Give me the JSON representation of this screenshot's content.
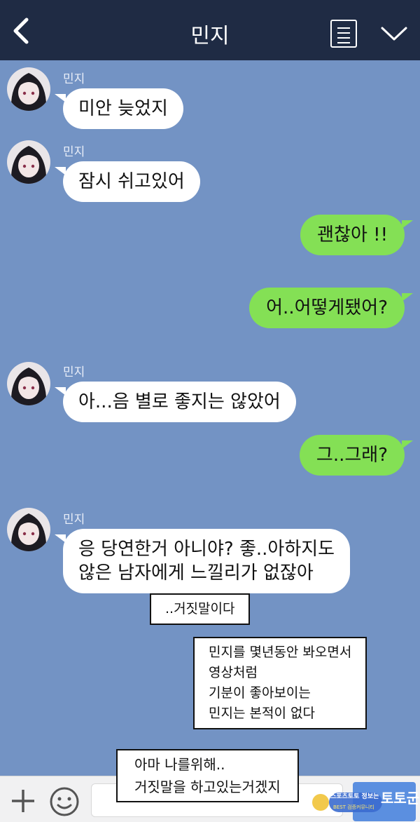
{
  "header": {
    "title": "민지"
  },
  "chat": {
    "contact": "민지",
    "messages": [
      {
        "from": "in",
        "text": "미안 늦었지"
      },
      {
        "from": "in",
        "text": "잠시 쉬고있어"
      },
      {
        "from": "out",
        "text": "괜찮아 !!"
      },
      {
        "from": "out",
        "text": "어..어떻게됐어?"
      },
      {
        "from": "in",
        "text": "아...음 별로 좋지는 않았어"
      },
      {
        "from": "out",
        "text": "그..그래?"
      },
      {
        "from": "in",
        "text": "응 당연한거 아니야? 좋..아하지도\n않은 남자에게 느낄리가 없잖아"
      }
    ],
    "narration": [
      "..거짓말이다",
      "민지를 몇년동안 봐오면서\n영상처럼\n기분이 좋아보이는\n민지는 본적이 없다",
      "아마 나를위해..\n거짓말을 하고있는거겠지"
    ]
  },
  "input": {
    "placeholder": ""
  },
  "watermark": {
    "line1": "스포츠토토 정보는",
    "line2": "BEST 검증커뮤니티",
    "brand": "토토군"
  },
  "colors": {
    "header": "#1f2b44",
    "background": "#7393c4",
    "outgoing": "#84e055",
    "incoming": "#ffffff",
    "send": "#5b8fe0"
  }
}
